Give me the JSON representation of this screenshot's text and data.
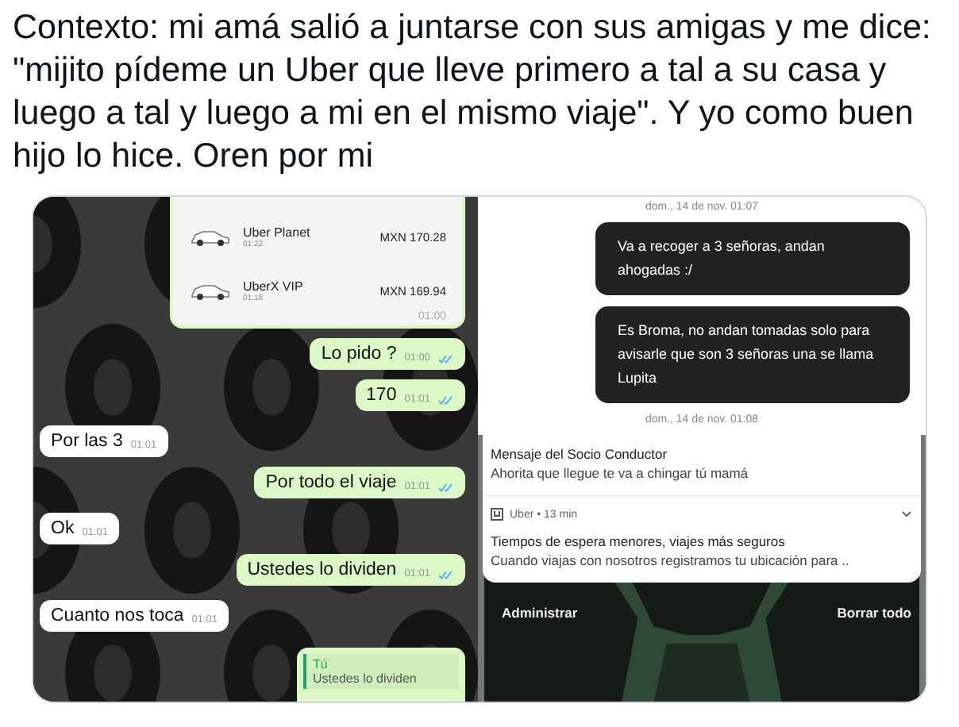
{
  "tweet": {
    "text": "Contexto: mi amá salió a juntarse con sus amigas y me dice: \"mijito pídeme un Uber que lleve primero a tal a su casa y luego a tal y luego a mi en el mismo viaje\". Y yo como buen hijo lo hice. Oren por mi"
  },
  "left_screenshot": {
    "uber_options": [
      {
        "name": "Uber Planet",
        "time": "01:22",
        "price": "MXN 170.28"
      },
      {
        "name": "UberX VIP",
        "time": "01:18",
        "price": "MXN 169.94"
      }
    ],
    "card_time": "01:00",
    "messages": [
      {
        "kind": "sent",
        "text": "Lo pido ?",
        "time": "01:00"
      },
      {
        "kind": "sent",
        "text": "170",
        "time": "01:01"
      },
      {
        "kind": "received",
        "text": "Por las 3",
        "time": "01:01"
      },
      {
        "kind": "sent",
        "text": "Por todo el viaje",
        "time": "01:01"
      },
      {
        "kind": "received",
        "text": "Ok",
        "time": "01:01"
      },
      {
        "kind": "sent",
        "text": "Ustedes lo dividen",
        "time": "01:01"
      },
      {
        "kind": "received",
        "text": "Cuanto nos toca",
        "time": "01:01"
      }
    ],
    "reply": {
      "author": "Tú",
      "quote": "Ustedes lo dividen"
    }
  },
  "right_screenshot": {
    "date_1": "dom., 14 de nov. 01:07",
    "bubbles": [
      "Va a recoger a 3 señoras, andan ahogadas :/",
      "Es Broma, no andan tomadas solo para avisarle que son 3 señoras una se llama Lupita"
    ],
    "date_2": "dom., 14 de nov. 01:08",
    "notifications": [
      {
        "kind": "message",
        "title": "Mensaje del Socio Conductor",
        "body": "Ahorita que llegue te va a chingar tú mamá"
      },
      {
        "kind": "app",
        "app": "Uber • 13 min",
        "title": "Tiempos de espera menores, viajes más seguros",
        "body": "Cuando viajas con nosotros registramos tu ubicación para .."
      }
    ],
    "actions": [
      "Administrar",
      "Borrar todo"
    ]
  }
}
